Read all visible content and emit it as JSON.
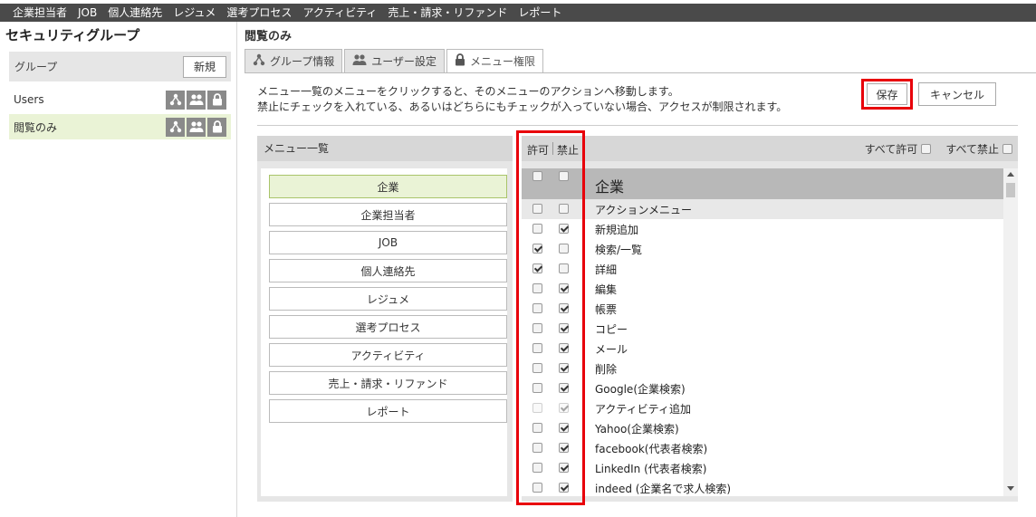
{
  "top_nav": [
    "企業担当者",
    "JOB",
    "個人連絡先",
    "レジュメ",
    "選考プロセス",
    "アクティビティ",
    "売上・請求・リファンド",
    "レポート"
  ],
  "sidebar": {
    "title": "セキュリティグループ",
    "group_label": "グループ",
    "new_button": "新規",
    "groups": [
      {
        "name": "Users",
        "active": false
      },
      {
        "name": "閲覧のみ",
        "active": true
      }
    ]
  },
  "main": {
    "title": "閲覧のみ",
    "tabs": [
      {
        "label": "グループ情報",
        "icon": "org-chart-icon",
        "active": false
      },
      {
        "label": "ユーザー設定",
        "icon": "users-icon",
        "active": false
      },
      {
        "label": "メニュー権限",
        "icon": "lock-icon",
        "active": true
      }
    ],
    "description_line1": "メニュー一覧のメニューをクリックすると、そのメニューのアクションへ移動します。",
    "description_line2": "禁止にチェックを入れている、あるいはどちらにもチェックが入っていない場合、アクセスが制限されます。",
    "save_button": "保存",
    "cancel_button": "キャンセル"
  },
  "menu_list": {
    "header": "メニュー一覧",
    "items": [
      "企業",
      "企業担当者",
      "JOB",
      "個人連絡先",
      "レジュメ",
      "選考プロセス",
      "アクティビティ",
      "売上・請求・リファンド",
      "レポート"
    ],
    "active_index": 0
  },
  "permissions": {
    "col_allow": "許可",
    "col_deny": "禁止",
    "all_allow": "すべて許可",
    "all_deny": "すべて禁止",
    "rows": [
      {
        "label": "企業",
        "type": "group",
        "allow": false,
        "deny": false
      },
      {
        "label": "アクションメニュー",
        "type": "action",
        "allow": false,
        "deny": false
      },
      {
        "label": "新規追加",
        "type": "item",
        "allow": false,
        "deny": true
      },
      {
        "label": "検索/一覧",
        "type": "item",
        "allow": true,
        "deny": false
      },
      {
        "label": "詳細",
        "type": "item",
        "allow": true,
        "deny": false
      },
      {
        "label": "編集",
        "type": "item",
        "allow": false,
        "deny": true
      },
      {
        "label": "帳票",
        "type": "item",
        "allow": false,
        "deny": true
      },
      {
        "label": "コピー",
        "type": "item",
        "allow": false,
        "deny": true
      },
      {
        "label": "メール",
        "type": "item",
        "allow": false,
        "deny": true
      },
      {
        "label": "削除",
        "type": "item",
        "allow": false,
        "deny": true
      },
      {
        "label": "Google(企業検索)",
        "type": "item",
        "allow": false,
        "deny": true
      },
      {
        "label": "アクティビティ追加",
        "type": "item",
        "allow": false,
        "deny": true,
        "disabled": true
      },
      {
        "label": "Yahoo(企業検索)",
        "type": "item",
        "allow": false,
        "deny": true
      },
      {
        "label": "facebook(代表者検索)",
        "type": "item",
        "allow": false,
        "deny": true
      },
      {
        "label": "LinkedIn (代表者検索)",
        "type": "item",
        "allow": false,
        "deny": true
      },
      {
        "label": "indeed (企業名で求人検索)",
        "type": "item",
        "allow": false,
        "deny": true
      }
    ]
  },
  "colors": {
    "highlight": "#e8000a",
    "active_green": "#eaf3d6",
    "nav_bg": "#4a4a4a"
  }
}
